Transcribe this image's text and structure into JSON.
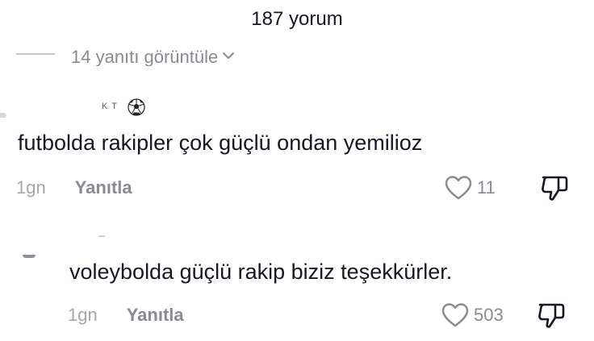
{
  "header": {
    "title": "187 yorum"
  },
  "replies": {
    "label": "14 yanıtı görüntüle"
  },
  "comments": [
    {
      "username": "K T",
      "text": "futbolda rakipler çok güçlü ondan yemilioz",
      "time": "1gn",
      "reply_label": "Yanıtla",
      "likes": "11"
    },
    {
      "text": "voleybolda güçlü rakip biziz teşekkürler.",
      "time": "1gn",
      "reply_label": "Yanıtla",
      "likes": "503"
    }
  ],
  "icons": {
    "heart": "heart-outline-icon",
    "dislike": "thumbs-down-icon",
    "chevron": "chevron-down-icon",
    "ball": "soccer-ball-icon"
  },
  "colors": {
    "text": "#161823",
    "secondary": "#8a8b91",
    "tertiary": "#a6a7ab"
  }
}
